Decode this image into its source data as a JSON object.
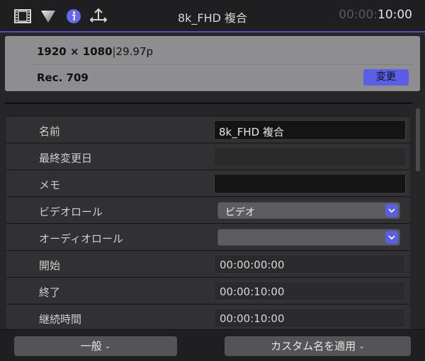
{
  "toolbar": {
    "icons": [
      "film-icon",
      "color-triangle-icon",
      "info-icon",
      "share-icon"
    ],
    "title": "8k_FHD 複合",
    "timecode_dim": "00:00:",
    "timecode_bright": "10:00",
    "accent": "#4b4fbf"
  },
  "summary": {
    "resolution": "1920 × 1080",
    "separator": "|",
    "framerate": "29.97p",
    "color_space": "Rec. 709",
    "change_label": "変更"
  },
  "properties": {
    "name_label": "名前",
    "name_value": "8k_FHD 複合",
    "modified_label": "最終変更日",
    "modified_value": "",
    "notes_label": "メモ",
    "notes_value": "",
    "video_role_label": "ビデオロール",
    "video_role_value": "ビデオ",
    "audio_role_label": "オーディオロール",
    "audio_role_value": "",
    "start_label": "開始",
    "start_value": "00:00:00:00",
    "end_label": "終了",
    "end_value": "00:00:10:00",
    "duration_label": "継続時間",
    "duration_value": "00:00:10:00"
  },
  "bottom": {
    "general_label": "一般",
    "apply_label": "カスタム名を適用",
    "chevron": "⌄"
  },
  "colors": {
    "accent_button": "#5a5ee6",
    "panel": "#8e8e90",
    "background": "#262628"
  }
}
